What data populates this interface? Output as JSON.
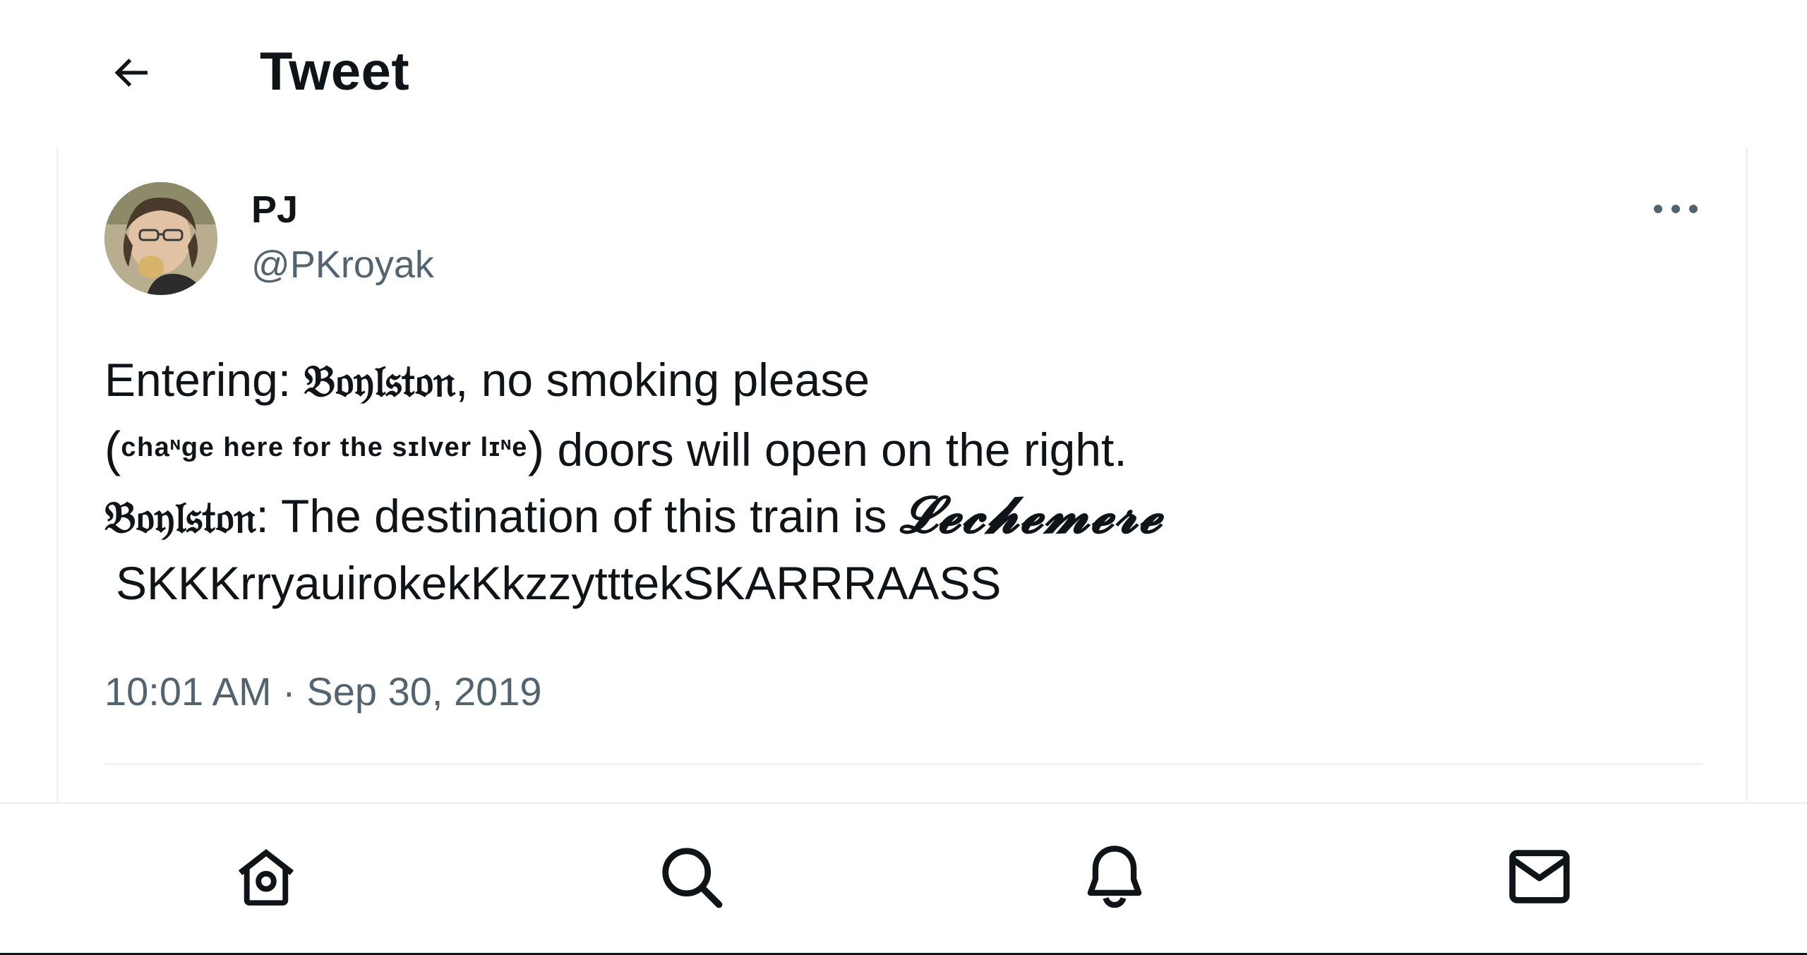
{
  "header": {
    "title": "Tweet",
    "back_icon": "arrow-left-icon"
  },
  "tweet": {
    "author": {
      "name": "PJ",
      "handle": "@PKroyak"
    },
    "lines": [
      {
        "parts": [
          {
            "text": "Entering: ",
            "style": "normal"
          },
          {
            "text": "𝔅𝔬𝔶𝔩𝔰𝔱𝔬𝔫",
            "style": "blackletter"
          },
          {
            "text": ", no smoking please",
            "style": "normal"
          }
        ]
      },
      {
        "parts": [
          {
            "text": "(",
            "style": "paren"
          },
          {
            "text": "chaᶰge here for the sɪlver lɪᶰe",
            "style": "small"
          },
          {
            "text": ")",
            "style": "paren"
          },
          {
            "text": " doors will open on the right.",
            "style": "normal"
          }
        ]
      },
      {
        "parts": [
          {
            "text": "𝔅𝔬𝔶𝔩𝔰𝔱𝔬𝔫",
            "style": "blackletter"
          },
          {
            "text": ": The destination of this train is ",
            "style": "normal"
          },
          {
            "text": "𝓛𝓮𝓬𝓱𝓮𝓶𝓮𝓻𝓮",
            "style": "script"
          }
        ]
      },
      {
        "parts": [
          {
            "text": " SKKKrryauirokekKkzzytttekSKARRRAASS",
            "style": "normal"
          }
        ]
      }
    ],
    "timestamp": "10:01 AM · Sep 30, 2019"
  },
  "icons": {
    "more": "more-horizontal-icon",
    "home": "home-icon",
    "search": "search-icon",
    "notifications": "bell-icon",
    "messages": "envelope-icon"
  },
  "colors": {
    "text_primary": "#0f1419",
    "text_secondary": "#536471",
    "border": "#eff3f4"
  }
}
